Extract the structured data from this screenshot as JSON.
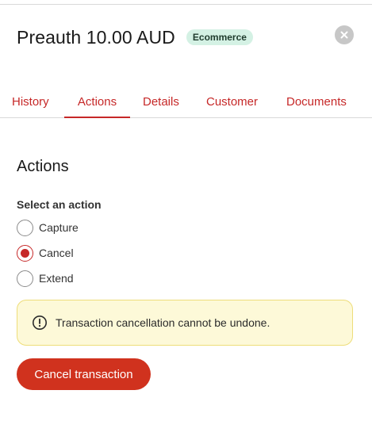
{
  "header": {
    "title": "Preauth 10.00 AUD",
    "badge": "Ecommerce"
  },
  "tabs": [
    {
      "label": "History",
      "active": false
    },
    {
      "label": "Actions",
      "active": true
    },
    {
      "label": "Details",
      "active": false
    },
    {
      "label": "Customer",
      "active": false
    },
    {
      "label": "Documents",
      "active": false
    }
  ],
  "section": {
    "title": "Actions",
    "field_label": "Select an action",
    "options": [
      {
        "label": "Capture",
        "selected": false
      },
      {
        "label": "Cancel",
        "selected": true
      },
      {
        "label": "Extend",
        "selected": false
      }
    ]
  },
  "alert": {
    "icon": "exclamation-circle-icon",
    "text": "Transaction cancellation cannot be undone."
  },
  "button": {
    "label": "Cancel transaction"
  },
  "colors": {
    "accent": "#c62828",
    "button": "#d0321e",
    "badge_bg": "#d4f1e4",
    "alert_bg": "#fdf9d8",
    "alert_border": "#eedd7a"
  }
}
